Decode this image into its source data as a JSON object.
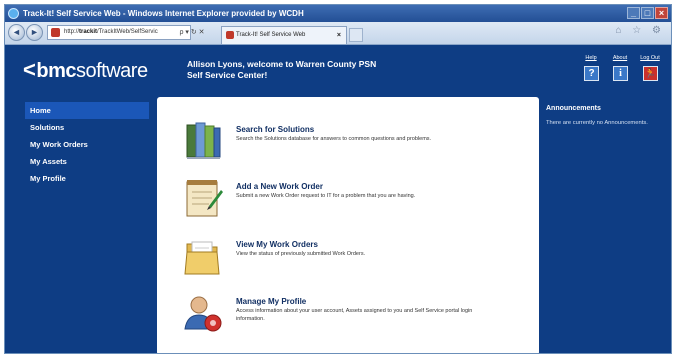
{
  "window": {
    "title": "Track-It! Self Service Web - Windows Internet Explorer provided by WCDH",
    "minimize": "_",
    "maximize": "□",
    "close": "×"
  },
  "browser": {
    "back": "◄",
    "forward": "►",
    "address_prefix": "http://",
    "address_host": "trackit",
    "address_path": "/TrackItWeb/SelfServic",
    "address_controls": "ρ ▾ ↻ ✕",
    "tab_title": "Track-It! Self Service Web",
    "tab_close": "×",
    "tools_icons": "⌂ ☆ ⚙"
  },
  "header": {
    "logo_chevron": "<",
    "logo_bold": "bmc",
    "logo_light": "software",
    "welcome_line1": "Allison Lyons, welcome to Warren County PSN",
    "welcome_line2": "Self Service Center!",
    "links": [
      {
        "label": "Help",
        "icon": "help-icon",
        "glyph": "?"
      },
      {
        "label": "About",
        "icon": "info-icon",
        "glyph": "i"
      },
      {
        "label": "Log Out",
        "icon": "logout-icon",
        "glyph": "🏃"
      }
    ]
  },
  "sidebar": {
    "items": [
      {
        "label": "Home",
        "active": true
      },
      {
        "label": "Solutions"
      },
      {
        "label": "My Work Orders"
      },
      {
        "label": "My Assets"
      },
      {
        "label": "My Profile"
      }
    ]
  },
  "main": {
    "items": [
      {
        "title": "Search for Solutions",
        "description": "Search the Solutions database for answers to common questions and problems.",
        "icon": "books-icon"
      },
      {
        "title": "Add a New Work Order",
        "description": "Submit a new Work Order request to IT for a problem that you are having.",
        "icon": "notepad-icon"
      },
      {
        "title": "View My Work Orders",
        "description": "View the status of previously submitted Work Orders.",
        "icon": "folder-icon"
      },
      {
        "title": "Manage My Profile",
        "description": "Access information about your user account, Assets assigned to you and Self Service portal login information.",
        "icon": "user-profile-icon"
      }
    ]
  },
  "announcements": {
    "heading": "Announcements",
    "body": "There are currently no Announcements."
  },
  "colors": {
    "page_bg": "#0e3d84",
    "active_nav": "#1b57b8",
    "title_text": "#112f63"
  }
}
